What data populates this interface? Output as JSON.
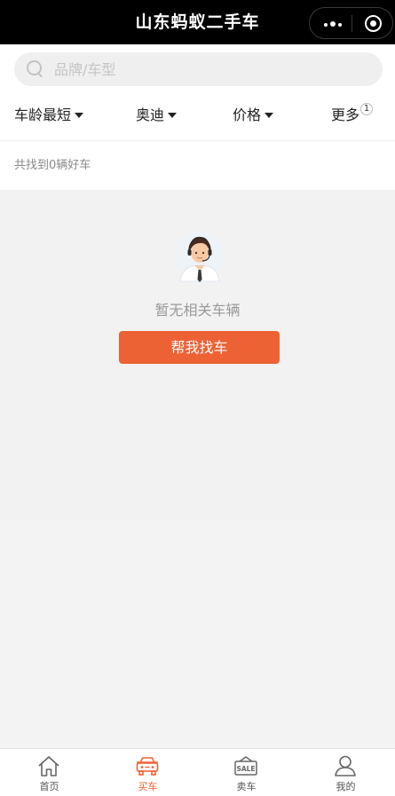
{
  "header": {
    "title": "山东蚂蚁二手车",
    "more_icon": "more-dots-icon",
    "close_icon": "target-icon"
  },
  "search": {
    "placeholder": "品牌/车型",
    "value": ""
  },
  "filters": [
    {
      "label": "车龄最短",
      "icon": "caret-down-icon"
    },
    {
      "label": "奥迪",
      "icon": "caret-down-icon"
    },
    {
      "label": "价格",
      "icon": "caret-down-icon"
    },
    {
      "label": "更多",
      "badge": "1"
    }
  ],
  "results": {
    "count_text": "共找到0辆好车"
  },
  "empty_state": {
    "avatar_icon": "customer-service-avatar-icon",
    "message": "暂无相关车辆",
    "button_label": "帮我找车"
  },
  "tabbar": {
    "active_color": "#ed6234",
    "items": [
      {
        "label": "首页",
        "icon": "home-icon",
        "active": false
      },
      {
        "label": "买车",
        "icon": "car-icon",
        "active": true
      },
      {
        "label": "卖车",
        "icon": "sale-tag-icon",
        "active": false
      },
      {
        "label": "我的",
        "icon": "user-icon",
        "active": false
      }
    ]
  },
  "colors": {
    "accent": "#ed6234",
    "header_bg": "#000000",
    "page_bg": "#f2f2f2"
  }
}
